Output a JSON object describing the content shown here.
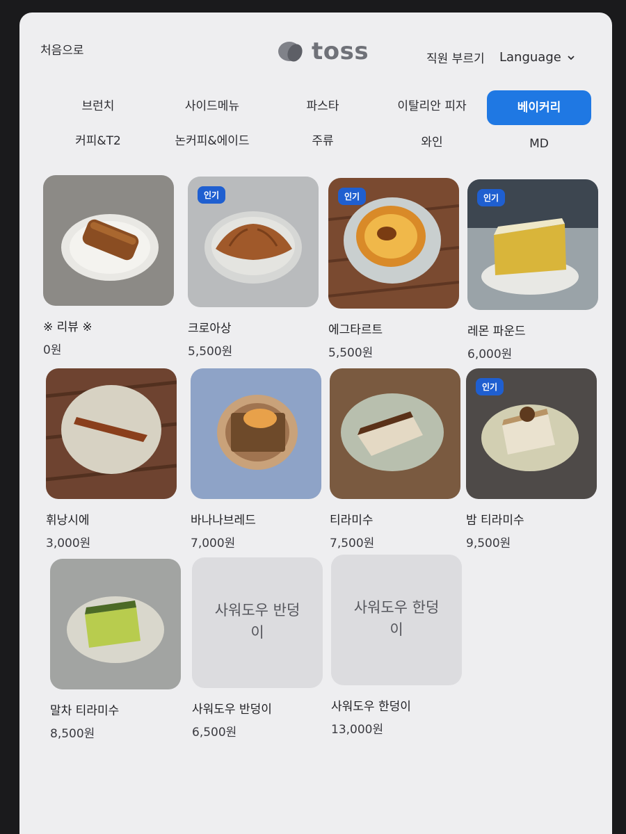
{
  "header": {
    "home_label": "처음으로",
    "brand_name": "toss",
    "call_staff_label": "직원 부르기",
    "language_label": "Language"
  },
  "tabs": [
    {
      "label": "브런치"
    },
    {
      "label": "사이드메뉴"
    },
    {
      "label": "파스타"
    },
    {
      "label": "이탈리안 피자"
    },
    {
      "label": "베이커리",
      "active": true
    },
    {
      "label": "커피&T2"
    },
    {
      "label": "논커피&에이드"
    },
    {
      "label": "주류"
    },
    {
      "label": "와인"
    },
    {
      "label": "MD"
    }
  ],
  "badge_label": "인기",
  "products": [
    {
      "name": "※ 리뷰 ※",
      "price": "0원",
      "popular": false
    },
    {
      "name": "크로아상",
      "price": "5,500원",
      "popular": true
    },
    {
      "name": "에그타르트",
      "price": "5,500원",
      "popular": true
    },
    {
      "name": "레몬 파운드",
      "price": "6,000원",
      "popular": true
    },
    {
      "name": "휘낭시에",
      "price": "3,000원",
      "popular": false
    },
    {
      "name": "바나나브레드",
      "price": "7,000원",
      "popular": false
    },
    {
      "name": "티라미수",
      "price": "7,500원",
      "popular": false
    },
    {
      "name": "밤 티라미수",
      "price": "9,500원",
      "popular": true
    },
    {
      "name": "말차 티라미수",
      "price": "8,500원",
      "popular": false
    },
    {
      "name": "사워도우 반덩이",
      "price": "6,500원",
      "popular": false,
      "placeholder": "사워도우 반덩\n이"
    },
    {
      "name": "사워도우 한덩이",
      "price": "13,000원",
      "popular": false,
      "placeholder": "사워도우 한덩\n이"
    }
  ],
  "colors": {
    "accent": "#1f78e3",
    "badge": "#1f5fd0",
    "background": "#eeeef0"
  }
}
